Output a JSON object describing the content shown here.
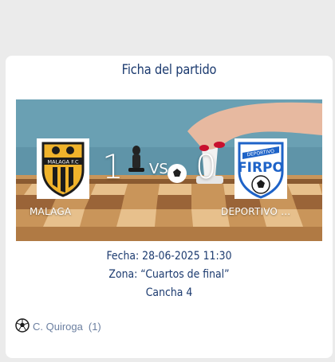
{
  "card": {
    "title": "Ficha del partido"
  },
  "match": {
    "home": {
      "name": "MALAGA",
      "score": "1",
      "logo_text": "MALAGA F.C"
    },
    "away": {
      "name": "DEPORTIVO F...",
      "score": "0",
      "logo_text_top": "DEPORTIVO",
      "logo_text_main": "FIRPO"
    },
    "vs_label": "VS",
    "date_line": "Fecha: 28-06-2025 11:30",
    "zone_line": "Zona: “Cuartos de final”",
    "court_line": "Cancha 4"
  },
  "scorers": [
    {
      "icon": "soccer-ball-icon",
      "name": "C. Quiroga",
      "goals": "(1)"
    }
  ],
  "colors": {
    "title": "#1b3a6f",
    "page_bg": "#ebebeb",
    "card_bg": "#ffffff",
    "home_logo_yellow": "#f0b32b",
    "away_logo_blue": "#1e63c8"
  }
}
